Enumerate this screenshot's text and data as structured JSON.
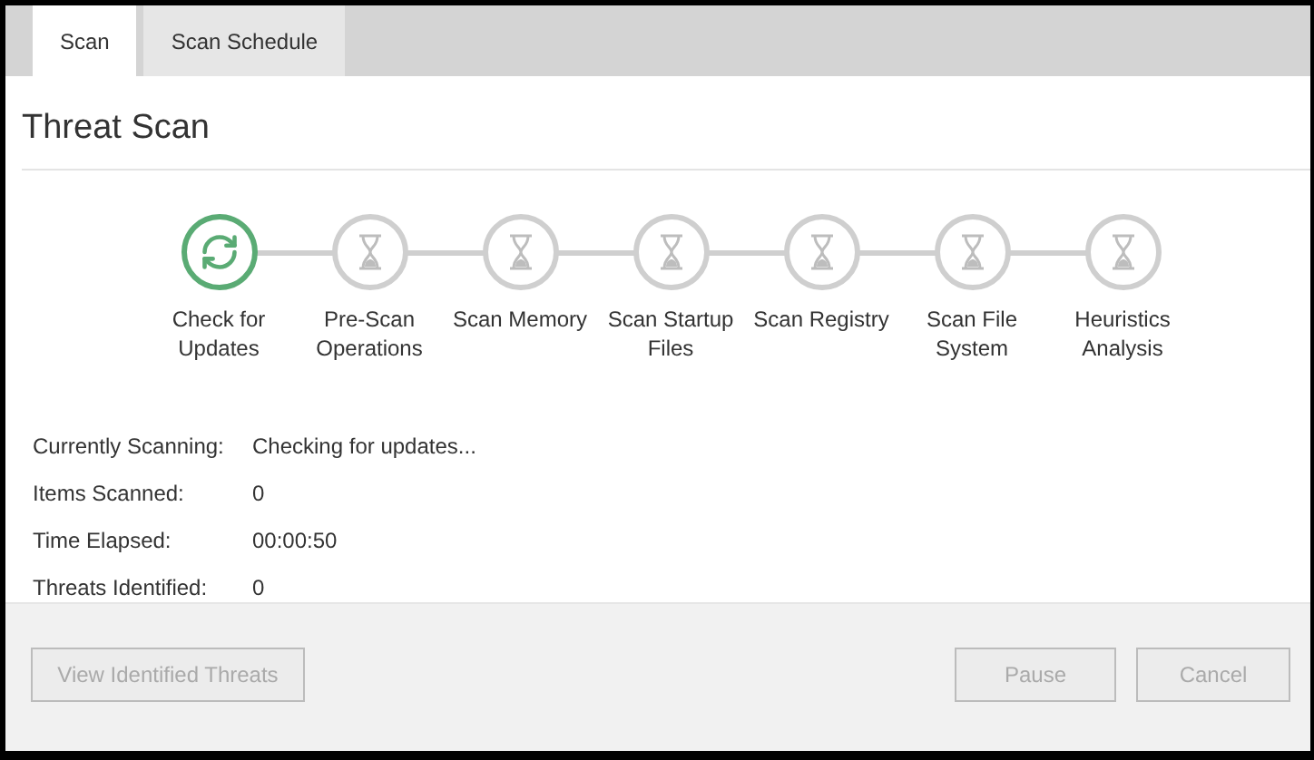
{
  "tabs": [
    {
      "label": "Scan",
      "selected": true
    },
    {
      "label": "Scan Schedule",
      "selected": false
    }
  ],
  "title": "Threat Scan",
  "steps": [
    {
      "label": "Check for Updates",
      "kind": "active"
    },
    {
      "label": "Pre-Scan Operations",
      "kind": "pending"
    },
    {
      "label": "Scan Memory",
      "kind": "pending"
    },
    {
      "label": "Scan Startup Files",
      "kind": "pending"
    },
    {
      "label": "Scan Registry",
      "kind": "pending"
    },
    {
      "label": "Scan File System",
      "kind": "pending"
    },
    {
      "label": "Heuristics Analysis",
      "kind": "pending"
    }
  ],
  "details": [
    {
      "label": "Currently Scanning:",
      "value": "Checking for updates..."
    },
    {
      "label": "Items Scanned:",
      "value": "0"
    },
    {
      "label": "Time Elapsed:",
      "value": "00:00:50"
    },
    {
      "label": "Threats Identified:",
      "value": "0"
    }
  ],
  "buttons": [
    {
      "label": "View Identified Threats",
      "disabled": true,
      "kind": "left"
    },
    {
      "label": "Pause",
      "disabled": true,
      "kind": "right"
    },
    {
      "label": "Cancel",
      "disabled": true,
      "kind": "right"
    }
  ]
}
